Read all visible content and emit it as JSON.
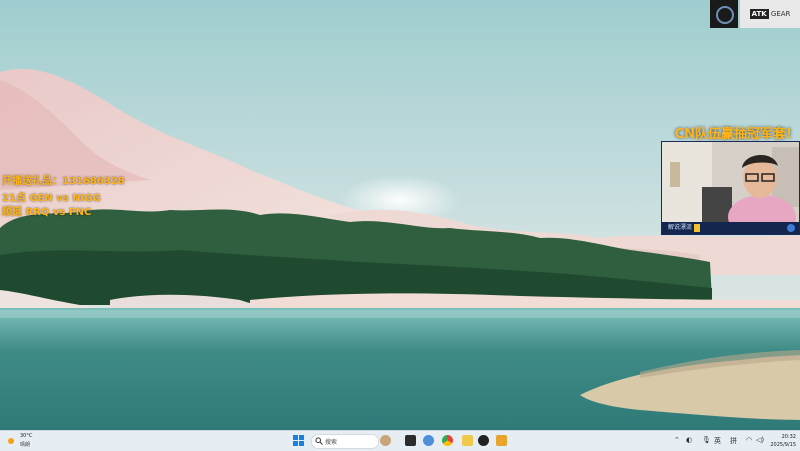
{
  "overlay": {
    "line1": "开播送礼品：131686328",
    "line2": "21点 GEN vs NIGG",
    "line3": "顺延 RRQ vs FNC"
  },
  "webcam": {
    "headline": "CN队伍赢抽冠军套!",
    "streamer_tag": "解说漂流"
  },
  "branding": {
    "logo": "ATK-logo-icon",
    "name_box": "ATK",
    "name_rest": "GEAR"
  },
  "taskbar": {
    "weather_temp": "30°C",
    "weather_desc": "晴朗",
    "search_placeholder": "搜索",
    "ime_lang": "英",
    "ime_mode": "拼",
    "time": "20:32",
    "date": "2025/9/15",
    "pinned_icons": [
      "people-icon",
      "file-explorer-icon",
      "browser-edge-icon",
      "chrome-icon",
      "notes-icon",
      "game-icon",
      "obs-icon",
      "folder-icon"
    ],
    "tray_icons": [
      "chevron-up-icon",
      "network-icon",
      "microphone-icon",
      "ime-lang",
      "ime-mode",
      "wifi-icon",
      "volume-icon"
    ]
  }
}
